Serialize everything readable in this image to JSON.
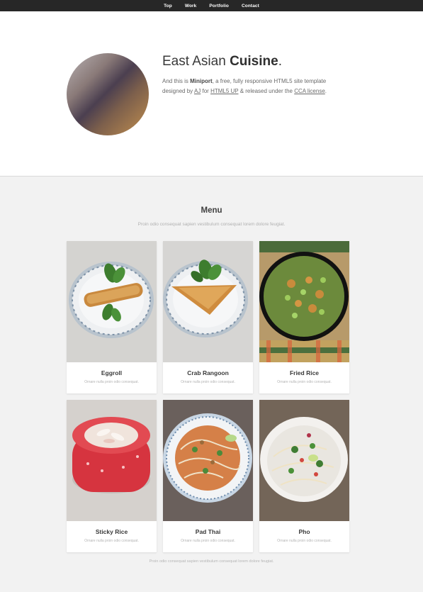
{
  "nav": {
    "items": [
      {
        "label": "Top"
      },
      {
        "label": "Work"
      },
      {
        "label": "Portfolio"
      },
      {
        "label": "Contact"
      }
    ]
  },
  "hero": {
    "title_light": "East Asian ",
    "title_bold": "Cuisine",
    "title_end": ".",
    "text_1": "And this is ",
    "text_brand": "Miniport",
    "text_2": ", a free, fully responsive HTML5 site template designed by ",
    "text_author": "AJ",
    "text_3": " for ",
    "text_html5up": "HTML5 UP",
    "text_4": " & released under the ",
    "text_license": "CCA license",
    "text_5": "."
  },
  "menu": {
    "title": "Menu",
    "subtitle": "Proin odio consequat sapien vestibulum consequat lorem dolore feugiat.",
    "items": [
      {
        "name": "Eggroll",
        "desc": "Ornare nulla proin odio consequat."
      },
      {
        "name": "Crab Rangoon",
        "desc": "Ornare nulla proin odio consequat."
      },
      {
        "name": "Fried Rice",
        "desc": "Ornare nulla proin odio consequat."
      },
      {
        "name": "Sticky Rice",
        "desc": "Ornare nulla proin odio consequat."
      },
      {
        "name": "Pad Thai",
        "desc": "Ornare nulla proin odio consequat."
      },
      {
        "name": "Pho",
        "desc": "Ornare nulla proin odio consequat."
      }
    ],
    "footer": "Proin odio consequat sapien vestibulum consequat lorem dolore feugiat."
  }
}
